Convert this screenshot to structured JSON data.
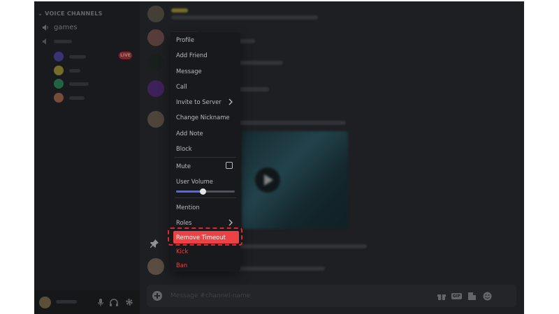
{
  "sidebar": {
    "category": "VOICE CHANNELS",
    "voice_channels": [
      "games"
    ],
    "live_badge": "LIVE"
  },
  "composer": {
    "placeholder": "Message #channel-name"
  },
  "context_menu": {
    "items": [
      "Profile",
      "Add Friend",
      "Message",
      "Call",
      "Invite to Server",
      "Change Nickname",
      "Add Note",
      "Block",
      "Mute",
      "User Volume",
      "Mention",
      "Roles",
      "Remove Timeout",
      "Kick",
      "Ban"
    ],
    "user_volume_fraction": 0.45,
    "highlighted_item": "Remove Timeout"
  },
  "colors": {
    "accent": "#5865f2",
    "danger": "#ed4245",
    "highlight_outline": "#e5252a"
  }
}
